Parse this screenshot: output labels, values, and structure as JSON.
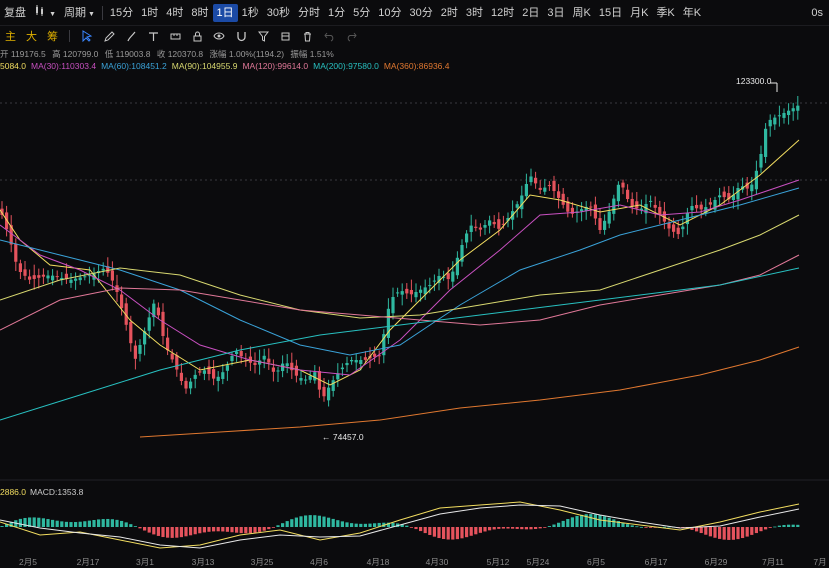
{
  "toolbar": {
    "title": "复盘",
    "chart_type_icon": "candle-type-icon",
    "period_label": "周期",
    "intervals": [
      "15分",
      "1时",
      "4时",
      "8时",
      "1日",
      "1秒",
      "30秒",
      "分时",
      "1分",
      "5分",
      "10分",
      "30分",
      "2时",
      "3时",
      "12时",
      "2日",
      "3日",
      "周K",
      "15日",
      "月K",
      "季K",
      "年K"
    ],
    "active_interval": "1日",
    "right_text": "0s"
  },
  "indicators": [
    "主",
    "大",
    "筹"
  ],
  "ohlc": {
    "open": "开 119176.5",
    "high": "高 120799.0",
    "low": "低 119003.8",
    "close": "收 120370.8",
    "change": "涨幅 1.00%(1194.2)",
    "amplitude": "振幅 1.51%"
  },
  "ma_legend": [
    {
      "text": "5084.0",
      "color": "#f2dd60"
    },
    {
      "text": "MA(30):110303.4",
      "color": "#c850c0"
    },
    {
      "text": "MA(60):108451.2",
      "color": "#3aa2d8"
    },
    {
      "text": "MA(90):104955.9",
      "color": "#d8d870"
    },
    {
      "text": "MA(120):99614.0",
      "color": "#e07898"
    },
    {
      "text": "MA(200):97580.0",
      "color": "#28c0c0"
    },
    {
      "text": "MA(360):86936.4",
      "color": "#e07830"
    }
  ],
  "annotations": {
    "max": "123300.0",
    "min": "74457.0"
  },
  "macd_legend": [
    {
      "text": "2886.0",
      "color": "#f2dd60"
    },
    {
      "text": "MACD:1353.8",
      "color": "#cccccc"
    }
  ],
  "colors": {
    "up": "#2fb8a0",
    "down": "#e5535d",
    "accent": "#1b4aa5"
  },
  "chart_data": {
    "type": "candlestick",
    "x_ticks": [
      "2月5",
      "2月17",
      "3月1",
      "3月13",
      "3月25",
      "4月6",
      "4月18",
      "4月30",
      "5月12",
      "5月24",
      "6月5",
      "6月17",
      "6月29",
      "7月11",
      "7月"
    ],
    "ohlc_daily": [],
    "highest": 123300.0,
    "lowest": 74457.0
  }
}
